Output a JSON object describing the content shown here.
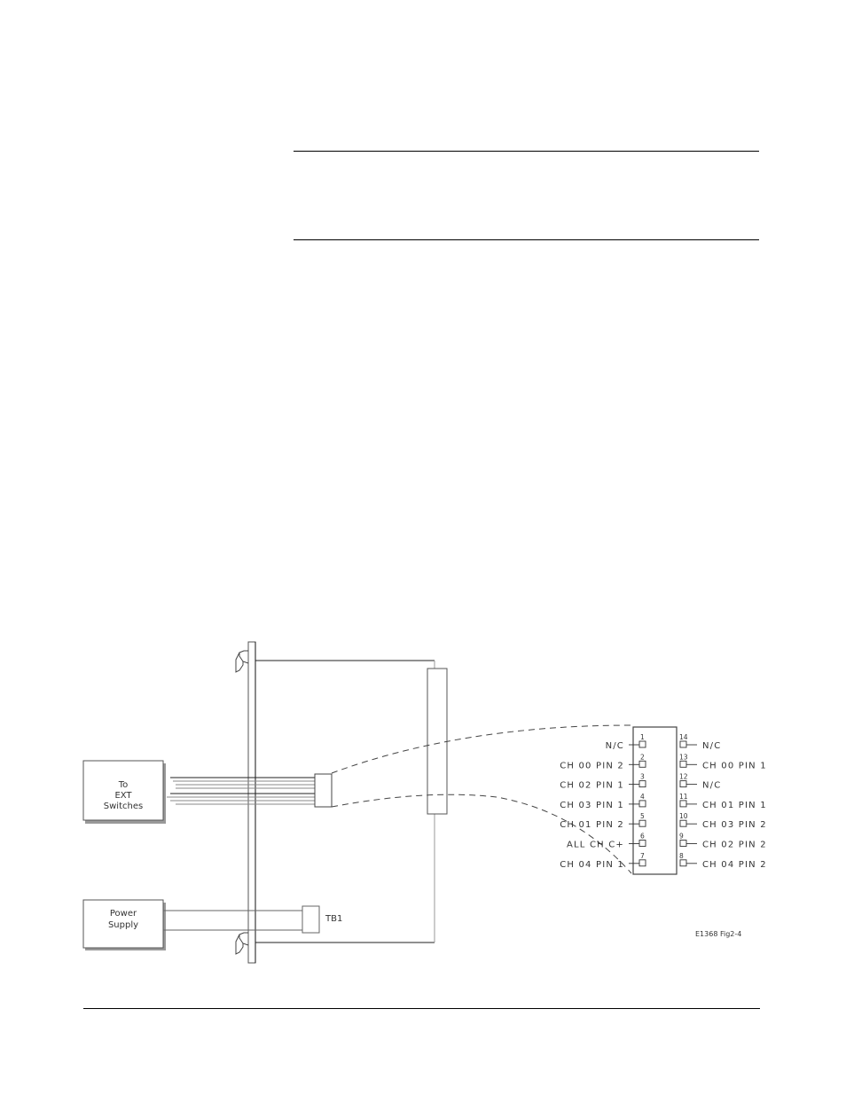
{
  "page": {
    "type": "manual-figure-page"
  },
  "diagram": {
    "figure_id": "E1368 Fig2-4",
    "blocks": {
      "ext_switches": [
        "To",
        "EXT",
        "Switches"
      ],
      "power_supply": [
        "Power",
        "Supply"
      ],
      "terminal_block": "TB1"
    },
    "connector_pins": {
      "left": [
        {
          "pin": "1",
          "label": "N/C"
        },
        {
          "pin": "2",
          "label": "CH 00 PIN 2"
        },
        {
          "pin": "3",
          "label": "CH 02 PIN 1"
        },
        {
          "pin": "4",
          "label": "CH 03 PIN 1"
        },
        {
          "pin": "5",
          "label": "CH 01 PIN 2"
        },
        {
          "pin": "6",
          "label": "ALL CH C+"
        },
        {
          "pin": "7",
          "label": "CH 04 PIN 1"
        }
      ],
      "right": [
        {
          "pin": "14",
          "label": "N/C"
        },
        {
          "pin": "13",
          "label": "CH 00 PIN 1"
        },
        {
          "pin": "12",
          "label": "N/C"
        },
        {
          "pin": "11",
          "label": "CH 01 PIN 1"
        },
        {
          "pin": "10",
          "label": "CH 03 PIN 2"
        },
        {
          "pin": "9",
          "label": "CH 02 PIN 2"
        },
        {
          "pin": "8",
          "label": "CH 04 PIN 2"
        }
      ]
    }
  }
}
